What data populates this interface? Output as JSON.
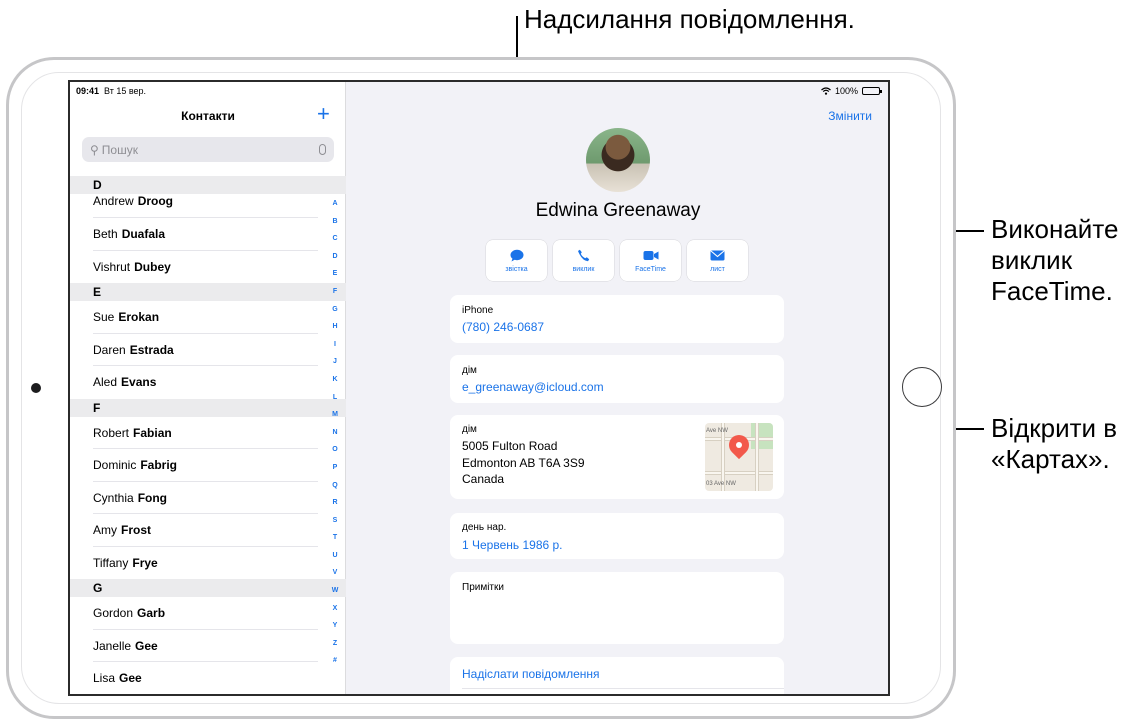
{
  "callouts": {
    "message": "Надсилання повідомлення.",
    "facetime": [
      "Виконайте",
      "виклик",
      "FaceTime."
    ],
    "maps": [
      "Відкрити в",
      "«Картах»."
    ]
  },
  "status_bar": {
    "time": "09:41",
    "date": "Вт 15 вер.",
    "battery": "100%"
  },
  "sidebar": {
    "title": "Контакти",
    "add_icon": "plus-icon",
    "search_placeholder": "Пошук",
    "sections": [
      {
        "letter": "D",
        "contacts": [
          {
            "first": "Andrew",
            "last": "Droog"
          },
          {
            "first": "Beth",
            "last": "Duafala"
          },
          {
            "first": "Vishrut",
            "last": "Dubey"
          }
        ]
      },
      {
        "letter": "E",
        "contacts": [
          {
            "first": "Sue",
            "last": "Erokan"
          },
          {
            "first": "Daren",
            "last": "Estrada"
          },
          {
            "first": "Aled",
            "last": "Evans"
          }
        ]
      },
      {
        "letter": "F",
        "contacts": [
          {
            "first": "Robert",
            "last": "Fabian"
          },
          {
            "first": "Dominic",
            "last": "Fabrig"
          },
          {
            "first": "Cynthia",
            "last": "Fong"
          },
          {
            "first": "Amy",
            "last": "Frost"
          },
          {
            "first": "Tiffany",
            "last": "Frye"
          }
        ]
      },
      {
        "letter": "G",
        "contacts": [
          {
            "first": "Gordon",
            "last": "Garb"
          },
          {
            "first": "Janelle",
            "last": "Gee"
          },
          {
            "first": "Lisa",
            "last": "Gee"
          }
        ]
      }
    ],
    "index_letters": [
      "A",
      "B",
      "C",
      "D",
      "E",
      "F",
      "G",
      "H",
      "I",
      "J",
      "K",
      "L",
      "M",
      "N",
      "O",
      "P",
      "Q",
      "R",
      "S",
      "T",
      "U",
      "V",
      "W",
      "X",
      "Y",
      "Z",
      "#"
    ]
  },
  "detail": {
    "edit_label": "Змінити",
    "name": "Edwina Greenaway",
    "actions": [
      {
        "label": "звістка",
        "icon": "message-bubble-icon"
      },
      {
        "label": "виклик",
        "icon": "phone-icon"
      },
      {
        "label": "FaceTime",
        "icon": "video-camera-icon"
      },
      {
        "label": "лист",
        "icon": "envelope-icon"
      }
    ],
    "phone": {
      "label": "iPhone",
      "value": "(780) 246-0687"
    },
    "email": {
      "label": "дім",
      "value": "e_greenaway@icloud.com"
    },
    "address": {
      "label": "дім",
      "line1": "5005 Fulton Road",
      "line2": "Edmonton AB T6A 3S9",
      "line3": "Canada",
      "map_labels": [
        "Ave NW",
        "03 Ave NW"
      ]
    },
    "birthday": {
      "label": "день нар.",
      "value": "1 Червень 1986 р."
    },
    "notes": {
      "label": "Примітки"
    },
    "send_message": "Надіслати повідомлення"
  },
  "colors": {
    "accent": "#1a73e8",
    "map_pin": "#f2594b"
  }
}
